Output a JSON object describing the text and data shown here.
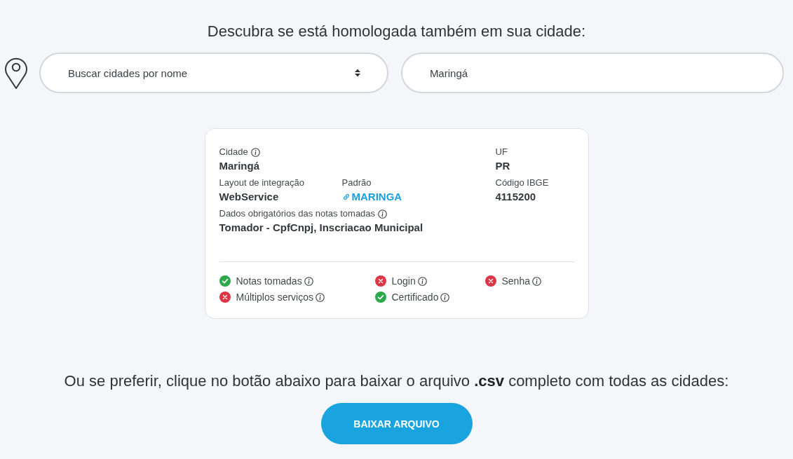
{
  "heading": "Descubra se está homologada também em sua cidade:",
  "city_select": {
    "value": "Buscar cidades por nome"
  },
  "search_field": {
    "value": "Maringá"
  },
  "city_card": {
    "city": {
      "label": "Cidade",
      "value": "Maringá"
    },
    "uf": {
      "label": "UF",
      "value": "PR"
    },
    "integration_layout": {
      "label": "Layout de integração",
      "value": "WebService"
    },
    "standard": {
      "label": "Padrão",
      "value": "MARINGA"
    },
    "ibge_code": {
      "label": "Código IBGE",
      "value": "4115200"
    },
    "required_data": {
      "label": "Dados obrigatórios das notas tomadas",
      "value": "Tomador - CpfCnpj, Inscriacao Municipal"
    },
    "capabilities": [
      {
        "label": "Notas tomadas",
        "supported": true
      },
      {
        "label": "Login",
        "supported": false
      },
      {
        "label": "Senha",
        "supported": false
      },
      {
        "label": "Múltiplos serviços",
        "supported": false
      },
      {
        "label": "Certificado",
        "supported": true
      }
    ]
  },
  "csv_note": "Ou se preferir, clique no botão abaixo para baixar o arquivo **.csv** completo com todas as cidades:",
  "download_button": {
    "label": "BAIXAR ARQUIVO"
  }
}
